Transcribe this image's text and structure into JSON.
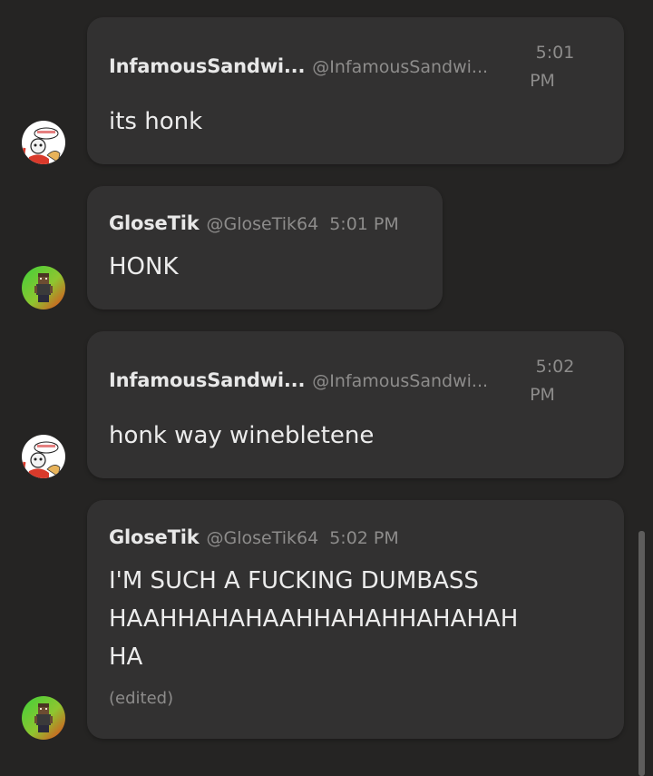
{
  "messages": [
    {
      "name": "InfamousSandwi...",
      "handle": "@InfamousSandwi...",
      "time_hm": "5:01",
      "time_ampm": "PM",
      "text": "its honk",
      "avatar": "papyrus-avatar"
    },
    {
      "name": "GloseTik",
      "handle": "@GloseTik64",
      "time": "5:01 PM",
      "text": "HONK",
      "avatar": "pixel-character-avatar"
    },
    {
      "name": "InfamousSandwi...",
      "handle": "@InfamousSandwi...",
      "time_hm": "5:02",
      "time_ampm": "PM",
      "text": "honk way winebletene",
      "avatar": "papyrus-avatar"
    },
    {
      "name": "GloseTik",
      "handle": "@GloseTik64",
      "time": "5:02 PM",
      "text_lines": [
        "I'M SUCH A FUCKING DUMBASS",
        "HAAHHAHAHAAHHAHAHHAHAHAH",
        "HA"
      ],
      "edited": "(edited)",
      "avatar": "pixel-character-avatar"
    }
  ],
  "colors": {
    "background": "#252423",
    "bubble": "#323131",
    "name": "#e8e8e8",
    "meta": "#8d8c8b",
    "text": "#ececec"
  }
}
